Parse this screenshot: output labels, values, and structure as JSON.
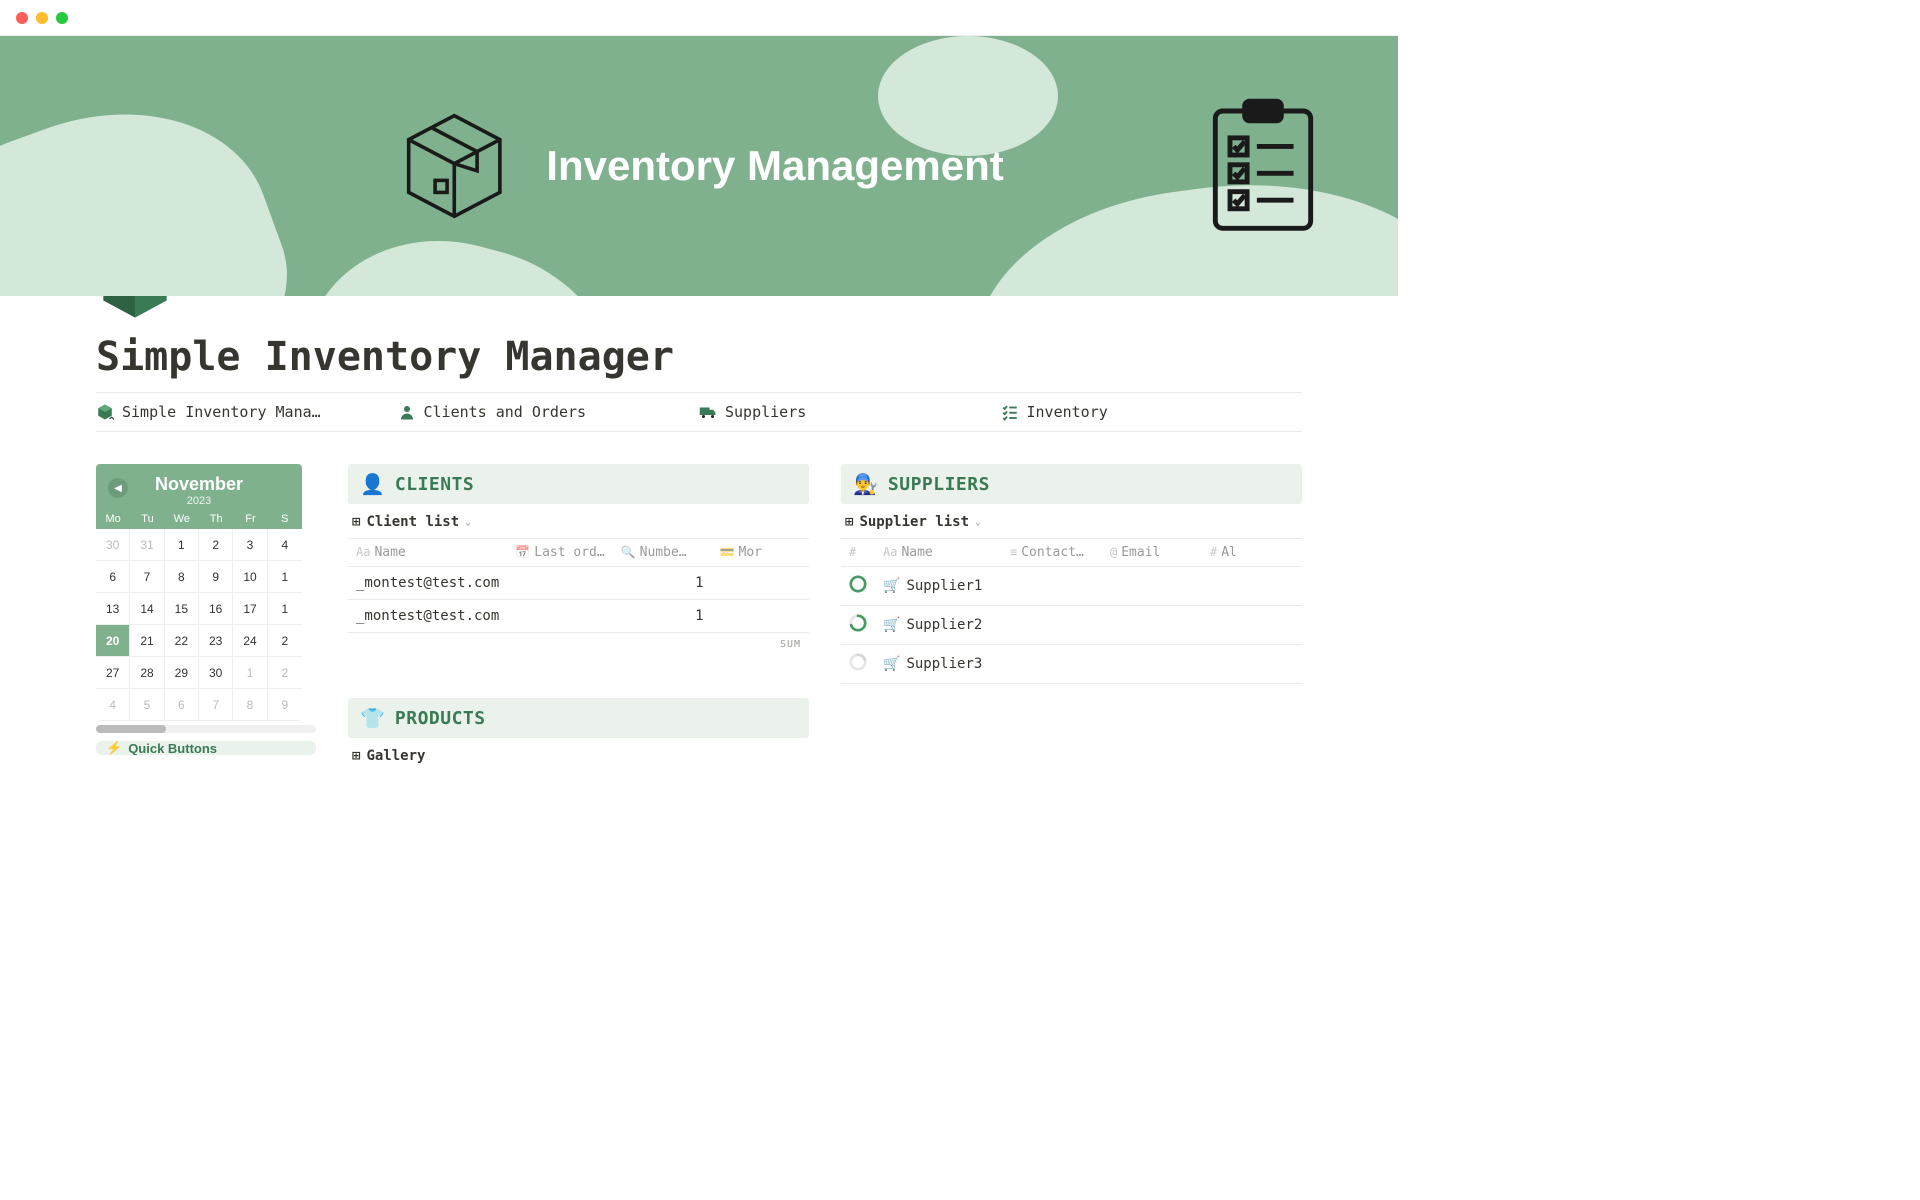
{
  "cover": {
    "title": "Inventory Management"
  },
  "page": {
    "title": "Simple Inventory Manager"
  },
  "tabs": [
    {
      "label": "Simple Inventory Mana…"
    },
    {
      "label": "Clients and Orders"
    },
    {
      "label": "Suppliers"
    },
    {
      "label": "Inventory"
    }
  ],
  "calendar": {
    "month": "November",
    "year": "2023",
    "dow": [
      "Mo",
      "Tu",
      "We",
      "Th",
      "Fr",
      "S"
    ],
    "weeks": [
      [
        {
          "d": "30",
          "dim": true
        },
        {
          "d": "31",
          "dim": true
        },
        {
          "d": "1"
        },
        {
          "d": "2"
        },
        {
          "d": "3"
        },
        {
          "d": "4"
        }
      ],
      [
        {
          "d": "6"
        },
        {
          "d": "7"
        },
        {
          "d": "8"
        },
        {
          "d": "9"
        },
        {
          "d": "10"
        },
        {
          "d": "1"
        }
      ],
      [
        {
          "d": "13"
        },
        {
          "d": "14"
        },
        {
          "d": "15"
        },
        {
          "d": "16"
        },
        {
          "d": "17"
        },
        {
          "d": "1"
        }
      ],
      [
        {
          "d": "20",
          "today": true
        },
        {
          "d": "21"
        },
        {
          "d": "22"
        },
        {
          "d": "23"
        },
        {
          "d": "24"
        },
        {
          "d": "2"
        }
      ],
      [
        {
          "d": "27"
        },
        {
          "d": "28"
        },
        {
          "d": "29"
        },
        {
          "d": "30"
        },
        {
          "d": "1",
          "dim": true
        },
        {
          "d": "2",
          "dim": true
        }
      ],
      [
        {
          "d": "4",
          "dim": true
        },
        {
          "d": "5",
          "dim": true
        },
        {
          "d": "6",
          "dim": true
        },
        {
          "d": "7",
          "dim": true
        },
        {
          "d": "8",
          "dim": true
        },
        {
          "d": "9",
          "dim": true
        }
      ]
    ],
    "quick_buttons": "Quick Buttons"
  },
  "clients": {
    "emoji": "👤",
    "title": "CLIENTS",
    "view": "Client list",
    "cols": {
      "name": "Name",
      "last_ord": "Last ord…",
      "number": "Numbe…",
      "money": "Mor"
    },
    "rows": [
      {
        "name": "_montest@test.com",
        "num": "1"
      },
      {
        "name": "_montest@test.com",
        "num": "1"
      }
    ],
    "sum": "SUM"
  },
  "suppliers": {
    "emoji": "👨‍🔧",
    "title": "SUPPLIERS",
    "view": "Supplier list",
    "cols": {
      "name": "Name",
      "contact": "Contact…",
      "email": "Email",
      "al": "Al"
    },
    "rows": [
      {
        "name": "Supplier1",
        "ringcolor": "#4a9a66",
        "dash": "0"
      },
      {
        "name": "Supplier2",
        "ringcolor": "#4a9a66",
        "dash": "35 15"
      },
      {
        "name": "Supplier3",
        "ringcolor": "#cfd9d2",
        "dash": "10 40"
      }
    ]
  },
  "products": {
    "emoji": "👕",
    "title": "PRODUCTS",
    "view": "Gallery"
  }
}
